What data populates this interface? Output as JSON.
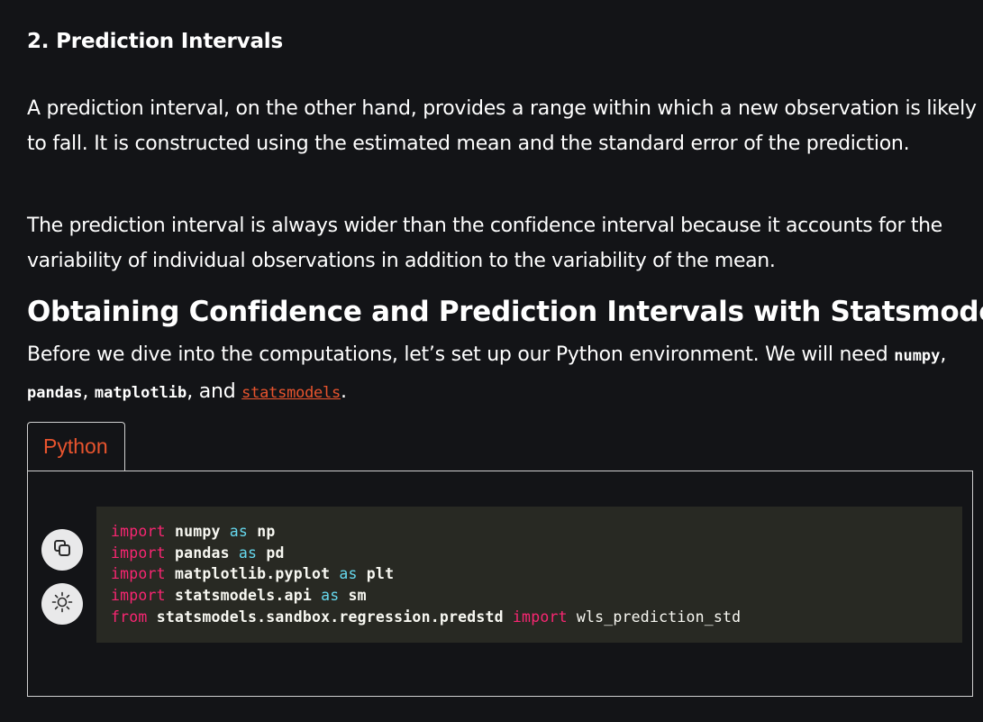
{
  "section": {
    "heading": "2. Prediction Intervals",
    "paragraph1": "A prediction interval, on the other hand, provides a range within which a new observation is likely to fall. It is constructed using the estimated mean and the standard error of the prediction.",
    "paragraph2": "The prediction interval is always wider than the confidence interval because it accounts for the variability of individual observations in addition to the variability of the mean."
  },
  "subsection": {
    "heading": "Obtaining Confidence and Prediction Intervals with Statsmodels",
    "intro_text": "Before we dive into the computations, let’s set up our Python environment. We will need",
    "pkg1": "numpy",
    "sep1": ",",
    "pkg2": "pandas",
    "sep2": ",",
    "pkg3": "matplotlib",
    "sep3": ", and",
    "pkg4_link": "statsmodels",
    "end": "."
  },
  "code_tabs": {
    "active_tab": "Python"
  },
  "code_controls": {
    "copy_icon": "copy-icon",
    "theme_icon": "sun-icon"
  },
  "code": {
    "lines": [
      {
        "kw": "import",
        "mod": "numpy",
        "as": "as",
        "alias": "np"
      },
      {
        "kw": "import",
        "mod": "pandas",
        "as": "as",
        "alias": "pd"
      },
      {
        "kw": "import",
        "mod": "matplotlib.pyplot",
        "as": "as",
        "alias": "plt"
      },
      {
        "kw": "import",
        "mod": "statsmodels.api",
        "as": "as",
        "alias": "sm"
      }
    ],
    "last_line": {
      "from": "from",
      "mod": "statsmodels.sandbox.regression.predstd",
      "imp": "import",
      "name": "wls_prediction_std"
    }
  },
  "colors": {
    "background": "#131417",
    "accent": "#e8542e",
    "code_bg": "#282923",
    "keyword_pink": "#f92672",
    "keyword_blue": "#66d9ef"
  }
}
